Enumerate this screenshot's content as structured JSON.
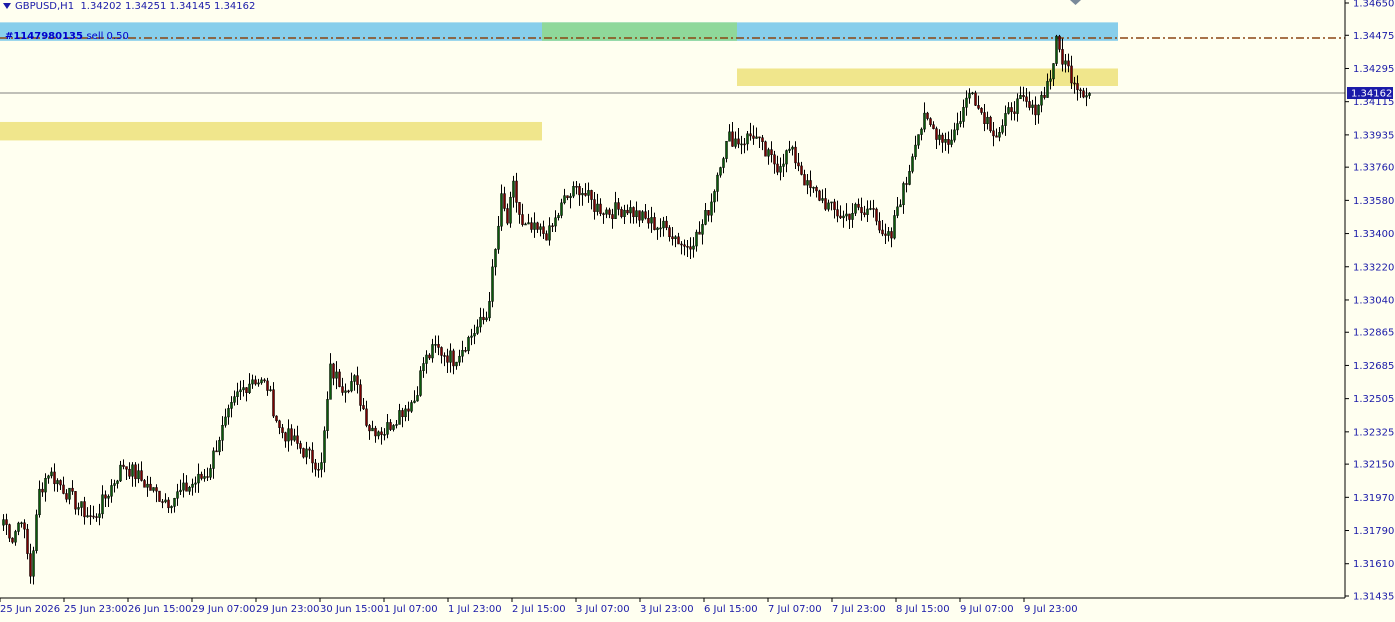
{
  "header": {
    "symbol": "GBPUSD,H1",
    "ohlc": "1.34202 1.34251 1.34145 1.34162"
  },
  "order": {
    "ticket": "#1147980135",
    "label": "sell 0.50"
  },
  "colors": {
    "background": "#fffff0",
    "axis_text": "#1a1aa8",
    "bull": "#0a5a0a",
    "bear": "#7a0000",
    "wick": "#000000",
    "zone_blue": "#87ceeb",
    "zone_green": "#8fd89a",
    "zone_yellow": "#f0e68c",
    "order_line": "#8b4513",
    "bid_line": "#808080",
    "price_tag": "#1a1aa8"
  },
  "chart_data": {
    "type": "candlestick",
    "symbol": "GBPUSD",
    "timeframe": "H1",
    "y_ticks": [
      1.3465,
      1.34475,
      1.34295,
      1.34115,
      1.33935,
      1.3376,
      1.3358,
      1.334,
      1.3322,
      1.3304,
      1.32865,
      1.32685,
      1.32505,
      1.32325,
      1.3215,
      1.3197,
      1.3179,
      1.3161,
      1.31435
    ],
    "y_tick_labels": [
      "1.34650",
      "1.34475",
      "1.34295",
      "1.34115",
      "1.33935",
      "1.33760",
      "1.33580",
      "1.33400",
      "1.33220",
      "1.33040",
      "1.32865",
      "1.32685",
      "1.32505",
      "1.32325",
      "1.32150",
      "1.31970",
      "1.31790",
      "1.31610",
      "1.31435"
    ],
    "ylim": [
      1.31435,
      1.3465
    ],
    "x_labels": [
      "25 Jun 2026",
      "25 Jun 23:00",
      "26 Jun 15:00",
      "29 Jun 07:00",
      "29 Jun 23:00",
      "30 Jun 15:00",
      "1 Jul 07:00",
      "1 Jul 23:00",
      "2 Jul 15:00",
      "3 Jul 07:00",
      "3 Jul 23:00",
      "6 Jul 15:00",
      "7 Jul 07:00",
      "7 Jul 23:00",
      "8 Jul 15:00",
      "9 Jul 07:00",
      "9 Jul 23:00"
    ],
    "current_price": 1.34162,
    "current_price_label": "1.34162",
    "order_price": 1.3446,
    "zones": [
      {
        "top": 1.34545,
        "bottom": 1.34445,
        "from_bar": 0,
        "to_bar": 372,
        "color": "blue"
      },
      {
        "top": 1.34545,
        "bottom": 1.34445,
        "from_bar": 180,
        "to_bar": 245,
        "color": "green"
      },
      {
        "top": 1.34295,
        "bottom": 1.342,
        "from_bar": 245,
        "to_bar": 372,
        "color": "yellow"
      },
      {
        "top": 1.34005,
        "bottom": 1.33905,
        "from_bar": 0,
        "to_bar": 180,
        "color": "yellow"
      }
    ],
    "waypoints": [
      [
        0,
        1.3185
      ],
      [
        3,
        1.3175
      ],
      [
        6,
        1.3187
      ],
      [
        9,
        1.3155
      ],
      [
        12,
        1.32
      ],
      [
        15,
        1.3211
      ],
      [
        20,
        1.3202
      ],
      [
        25,
        1.3192
      ],
      [
        30,
        1.3185
      ],
      [
        36,
        1.3203
      ],
      [
        40,
        1.3215
      ],
      [
        45,
        1.3208
      ],
      [
        50,
        1.32
      ],
      [
        55,
        1.3195
      ],
      [
        62,
        1.3203
      ],
      [
        68,
        1.321
      ],
      [
        72,
        1.323
      ],
      [
        78,
        1.3252
      ],
      [
        83,
        1.3262
      ],
      [
        88,
        1.3257
      ],
      [
        92,
        1.3234
      ],
      [
        97,
        1.3227
      ],
      [
        102,
        1.3219
      ],
      [
        106,
        1.3214
      ],
      [
        109,
        1.3266
      ],
      [
        113,
        1.3258
      ],
      [
        117,
        1.326
      ],
      [
        122,
        1.3235
      ],
      [
        127,
        1.3233
      ],
      [
        132,
        1.3243
      ],
      [
        137,
        1.325
      ],
      [
        140,
        1.327
      ],
      [
        144,
        1.3278
      ],
      [
        150,
        1.3272
      ],
      [
        156,
        1.3285
      ],
      [
        161,
        1.3295
      ],
      [
        164,
        1.333
      ],
      [
        166,
        1.3358
      ],
      [
        168,
        1.3346
      ],
      [
        170,
        1.3365
      ],
      [
        173,
        1.3343
      ],
      [
        178,
        1.3341
      ],
      [
        182,
        1.334
      ],
      [
        187,
        1.3358
      ],
      [
        192,
        1.3365
      ],
      [
        197,
        1.3355
      ],
      [
        202,
        1.3352
      ],
      [
        208,
        1.3354
      ],
      [
        212,
        1.3349
      ],
      [
        217,
        1.3345
      ],
      [
        222,
        1.3342
      ],
      [
        227,
        1.3333
      ],
      [
        232,
        1.334
      ],
      [
        236,
        1.3358
      ],
      [
        239,
        1.338
      ],
      [
        242,
        1.3392
      ],
      [
        246,
        1.339
      ],
      [
        250,
        1.3394
      ],
      [
        254,
        1.3383
      ],
      [
        258,
        1.3377
      ],
      [
        262,
        1.3385
      ],
      [
        265,
        1.3378
      ],
      [
        268,
        1.3365
      ],
      [
        272,
        1.336
      ],
      [
        276,
        1.3353
      ],
      [
        280,
        1.3349
      ],
      [
        284,
        1.3353
      ],
      [
        287,
        1.335
      ],
      [
        290,
        1.3357
      ],
      [
        293,
        1.3336
      ],
      [
        296,
        1.3338
      ],
      [
        298,
        1.3355
      ],
      [
        301,
        1.3368
      ],
      [
        304,
        1.3392
      ],
      [
        307,
        1.3401
      ],
      [
        311,
        1.3395
      ],
      [
        315,
        1.339
      ],
      [
        318,
        1.3399
      ],
      [
        321,
        1.3412
      ],
      [
        323,
        1.342
      ],
      [
        325,
        1.3408
      ],
      [
        328,
        1.3402
      ],
      [
        331,
        1.3394
      ],
      [
        333,
        1.3397
      ],
      [
        336,
        1.3409
      ],
      [
        340,
        1.3411
      ],
      [
        343,
        1.3406
      ],
      [
        346,
        1.3414
      ],
      [
        349,
        1.3425
      ],
      [
        351,
        1.3443
      ],
      [
        353,
        1.3435
      ],
      [
        356,
        1.3426
      ],
      [
        359,
        1.3419
      ],
      [
        362,
        1.3416
      ]
    ]
  }
}
